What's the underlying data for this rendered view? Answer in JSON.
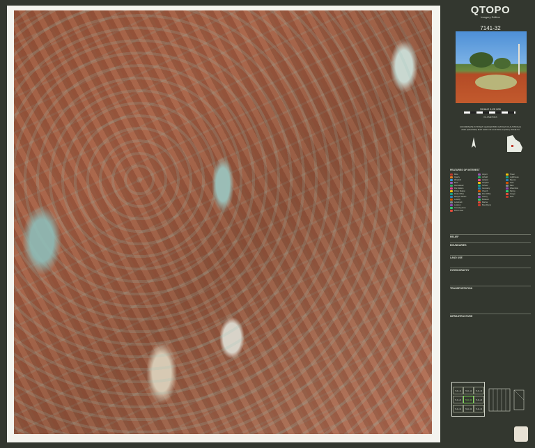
{
  "title_panel": {
    "brand": "QTOPO",
    "edition": "Imagery Edition",
    "sheet_number": "7141-32",
    "scale": "SCALE 1:25 000",
    "scale_units": "KILOMETRES",
    "datum_text": "COORDINATE SYSTEM: GEOCENTRIC DATUM OF AUSTRALIA 2020 (GDA2020) MAP GRID OF AUSTRALIA (MGA) ZONE 54"
  },
  "legend": {
    "heading": "FEATURES OF INTEREST",
    "col1": [
      "Mine",
      "Quarry",
      "Windmill",
      "Bore",
      "Homestead",
      "Fire Station",
      "Police Station",
      "Parks Office",
      "Ranger Station",
      "Locality",
      "Landmark",
      "Lookout",
      "Camping Area",
      "Picnic Area"
    ],
    "col2": [
      "Airport",
      "Airfield",
      "Heliport",
      "Hospital",
      "School",
      "Cemetery",
      "Church",
      "Post Office",
      "Library",
      "Museum",
      "Marina",
      "Boat Ramp"
    ],
    "col3": [
      "Tower",
      "Lighthouse",
      "Beacon",
      "Tank",
      "Dam",
      "Waterhole",
      "Spring",
      "Gauge",
      "Ruin"
    ],
    "sections": [
      "RELIEF",
      "BOUNDARIES",
      "LAND USE",
      "HYDROGRAPHY",
      "TRANSPORTATION",
      "INFRASTRUCTURE"
    ]
  },
  "index_map": {
    "cells": [
      "7141-11",
      "7141-12",
      "7141-13",
      "7141-21",
      "7141-32",
      "7141-23",
      "7141-31",
      "7141-33",
      "7141-34"
    ]
  },
  "colors": {
    "panel_bg": "#33372f",
    "map_border": "#f4f4ef",
    "earth": "#a05f45",
    "claypan": "#9bbdb6",
    "sand": "#d8d3c8"
  }
}
